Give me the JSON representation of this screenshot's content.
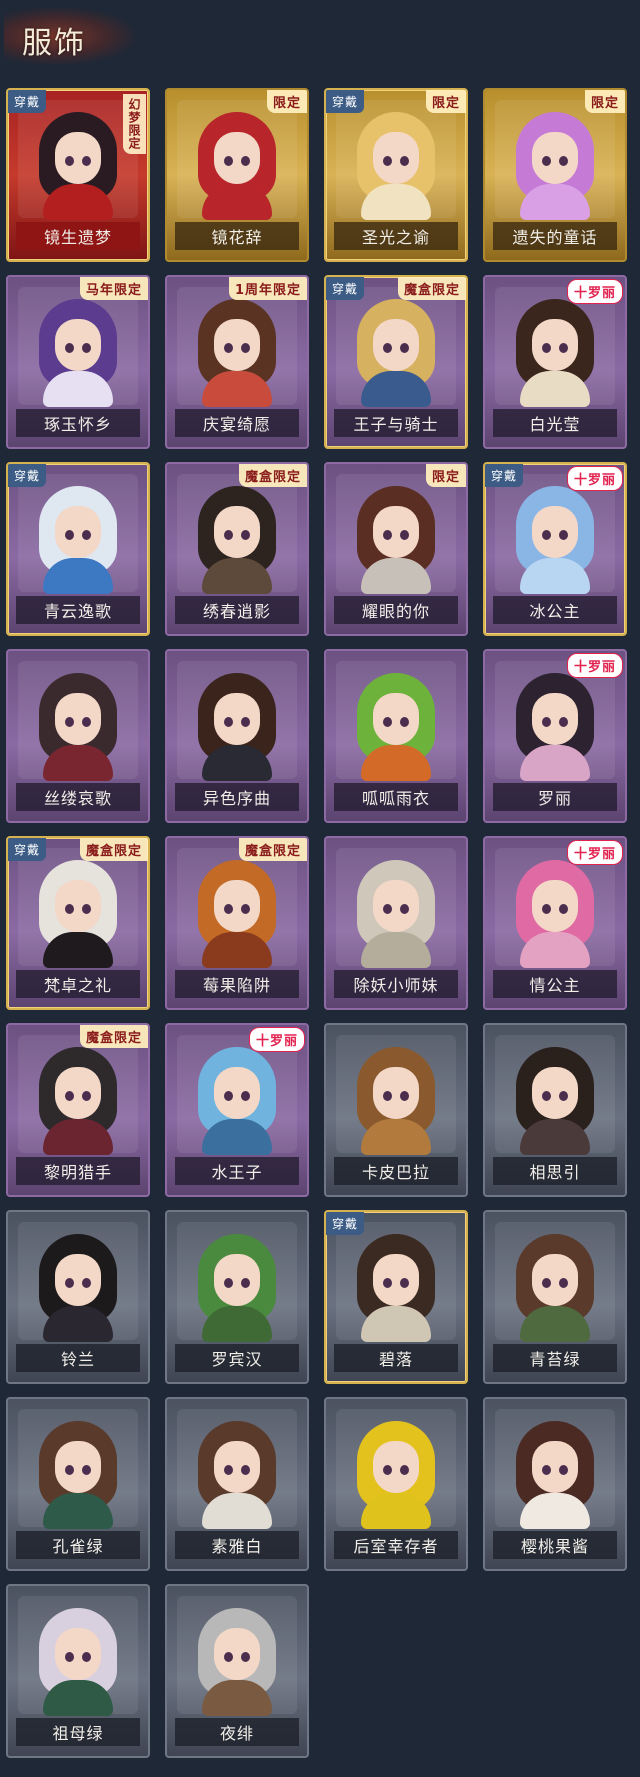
{
  "header": {
    "title": "服饰"
  },
  "rows": [
    [
      {
        "name": "镜生遗梦",
        "rarity": "red",
        "equipped": true,
        "tag": "幻梦限定",
        "tag_style": "vert",
        "hair": "#2a1b22",
        "clothes": "#b31e1e"
      },
      {
        "name": "镜花辞",
        "rarity": "gold",
        "equipped": false,
        "tag": "限定",
        "tag_style": "",
        "hair": "#b8252a",
        "clothes": "#b8252a"
      },
      {
        "name": "圣光之谕",
        "rarity": "gold",
        "equipped": true,
        "tag": "限定",
        "tag_style": "",
        "hair": "#e8c26a",
        "clothes": "#f1e3c1"
      },
      {
        "name": "遗失的童话",
        "rarity": "gold",
        "equipped": false,
        "tag": "限定",
        "tag_style": "",
        "hair": "#c57ad6",
        "clothes": "#d9a0e6"
      }
    ],
    [
      {
        "name": "琢玉怀乡",
        "rarity": "purple",
        "equipped": false,
        "tag": "马年限定",
        "tag_style": "",
        "hair": "#5b3c8f",
        "clothes": "#e6e0f2"
      },
      {
        "name": "庆宴绮愿",
        "rarity": "purple",
        "equipped": false,
        "tag": "1周年限定",
        "tag_style": "",
        "hair": "#5a3322",
        "clothes": "#c84b3c"
      },
      {
        "name": "王子与骑士",
        "rarity": "purple",
        "equipped": true,
        "tag": "魔盒限定",
        "tag_style": "",
        "hair": "#d6b15f",
        "clothes": "#3a5b8e"
      },
      {
        "name": "白光莹",
        "rarity": "purple",
        "equipped": false,
        "tag": "十罗丽",
        "tag_style": "pink",
        "hair": "#3a261c",
        "clothes": "#e9dcc4"
      }
    ],
    [
      {
        "name": "青云逸歌",
        "rarity": "purple",
        "equipped": true,
        "tag": "",
        "tag_style": "",
        "hair": "#dfe7f1",
        "clothes": "#3d78c2"
      },
      {
        "name": "绣春逍影",
        "rarity": "purple",
        "equipped": false,
        "tag": "魔盒限定",
        "tag_style": "",
        "hair": "#2d2420",
        "clothes": "#5e4a3a"
      },
      {
        "name": "耀眼的你",
        "rarity": "purple",
        "equipped": false,
        "tag": "限定",
        "tag_style": "",
        "hair": "#5a2e22",
        "clothes": "#c7c0b8"
      },
      {
        "name": "冰公主",
        "rarity": "purple",
        "equipped": true,
        "tag": "十罗丽",
        "tag_style": "pink",
        "hair": "#8ab6e6",
        "clothes": "#b8d6f2"
      }
    ],
    [
      {
        "name": "丝缕哀歌",
        "rarity": "purple",
        "equipped": false,
        "tag": "",
        "tag_style": "",
        "hair": "#3b2a2d",
        "clothes": "#7a2630"
      },
      {
        "name": "异色序曲",
        "rarity": "purple",
        "equipped": false,
        "tag": "",
        "tag_style": "",
        "hair": "#3a241b",
        "clothes": "#2a2a34"
      },
      {
        "name": "呱呱雨衣",
        "rarity": "purple",
        "equipped": false,
        "tag": "",
        "tag_style": "",
        "hair": "#6db23a",
        "clothes": "#d46a28"
      },
      {
        "name": "罗丽",
        "rarity": "purple",
        "equipped": false,
        "tag": "十罗丽",
        "tag_style": "pink",
        "hair": "#2c2230",
        "clothes": "#d9a5c6"
      }
    ],
    [
      {
        "name": "梵卓之礼",
        "rarity": "purple",
        "equipped": true,
        "tag": "魔盒限定",
        "tag_style": "",
        "hair": "#e6e2dc",
        "clothes": "#1e1a1e"
      },
      {
        "name": "莓果陷阱",
        "rarity": "purple",
        "equipped": false,
        "tag": "魔盒限定",
        "tag_style": "",
        "hair": "#c26a26",
        "clothes": "#8a3b1e"
      },
      {
        "name": "除妖小师妹",
        "rarity": "purple",
        "equipped": false,
        "tag": "",
        "tag_style": "",
        "hair": "#cfc7b9",
        "clothes": "#b4ad9c"
      },
      {
        "name": "情公主",
        "rarity": "purple",
        "equipped": false,
        "tag": "十罗丽",
        "tag_style": "pink",
        "hair": "#e06aa4",
        "clothes": "#e4a2c2"
      }
    ],
    [
      {
        "name": "黎明猎手",
        "rarity": "purple",
        "equipped": false,
        "tag": "魔盒限定",
        "tag_style": "",
        "hair": "#2e2a2c",
        "clothes": "#6b2530"
      },
      {
        "name": "水王子",
        "rarity": "purple",
        "equipped": false,
        "tag": "十罗丽",
        "tag_style": "pink",
        "hair": "#6fb3de",
        "clothes": "#3b6f9e"
      },
      {
        "name": "卡皮巴拉",
        "rarity": "gray",
        "equipped": false,
        "tag": "",
        "tag_style": "",
        "hair": "#8a5a2e",
        "clothes": "#b37a3e"
      },
      {
        "name": "相思引",
        "rarity": "gray",
        "equipped": false,
        "tag": "",
        "tag_style": "",
        "hair": "#2a201c",
        "clothes": "#4a3a3a"
      }
    ],
    [
      {
        "name": "铃兰",
        "rarity": "gray",
        "equipped": false,
        "tag": "",
        "tag_style": "",
        "hair": "#1d1a1c",
        "clothes": "#2b2730"
      },
      {
        "name": "罗宾汉",
        "rarity": "gray",
        "equipped": false,
        "tag": "",
        "tag_style": "",
        "hair": "#4a8a3e",
        "clothes": "#3f6a36"
      },
      {
        "name": "碧落",
        "rarity": "gray",
        "equipped": true,
        "tag": "",
        "tag_style": "",
        "hair": "#3a2a22",
        "clothes": "#d0c6b4"
      },
      {
        "name": "青苔绿",
        "rarity": "gray",
        "equipped": false,
        "tag": "",
        "tag_style": "",
        "hair": "#5a3a2a",
        "clothes": "#4e6a3e"
      }
    ],
    [
      {
        "name": "孔雀绿",
        "rarity": "gray",
        "equipped": false,
        "tag": "",
        "tag_style": "",
        "hair": "#5a3a2a",
        "clothes": "#2e5a4a"
      },
      {
        "name": "素雅白",
        "rarity": "gray",
        "equipped": false,
        "tag": "",
        "tag_style": "",
        "hair": "#5a3a2a",
        "clothes": "#e2ddd4"
      },
      {
        "name": "后室幸存者",
        "rarity": "gray",
        "equipped": false,
        "tag": "",
        "tag_style": "",
        "hair": "#e3c21e",
        "clothes": "#e0c21c"
      },
      {
        "name": "樱桃果酱",
        "rarity": "gray",
        "equipped": false,
        "tag": "",
        "tag_style": "",
        "hair": "#4a2a22",
        "clothes": "#efe9e2"
      }
    ],
    [
      {
        "name": "祖母绿",
        "rarity": "gray",
        "equipped": false,
        "tag": "",
        "tag_style": "",
        "hair": "#d8d0de",
        "clothes": "#2f5a46"
      },
      {
        "name": "夜绯",
        "rarity": "gray",
        "equipped": false,
        "tag": "",
        "tag_style": "",
        "hair": "#b8b8b8",
        "clothes": "#7a5a40"
      }
    ]
  ],
  "equipped_label": "穿戴"
}
